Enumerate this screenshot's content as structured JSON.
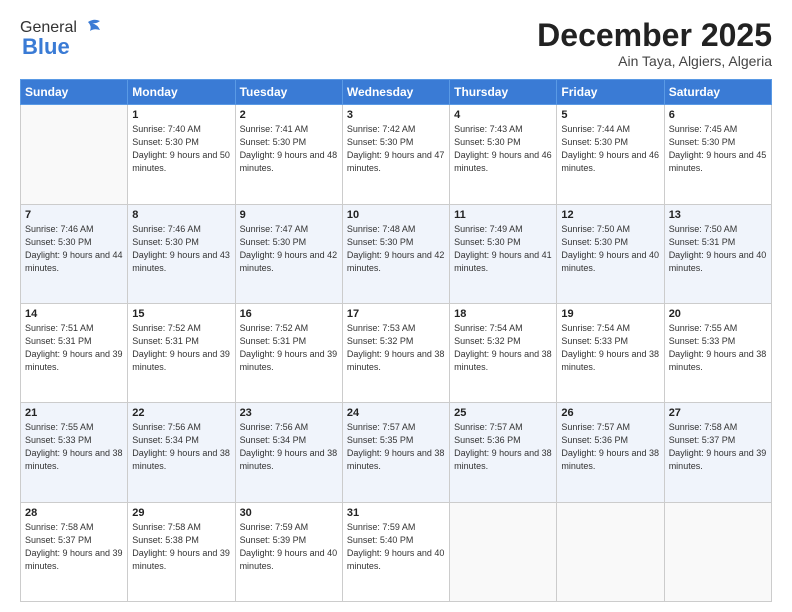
{
  "logo": {
    "general": "General",
    "blue": "Blue"
  },
  "header": {
    "month": "December 2025",
    "location": "Ain Taya, Algiers, Algeria"
  },
  "days_of_week": [
    "Sunday",
    "Monday",
    "Tuesday",
    "Wednesday",
    "Thursday",
    "Friday",
    "Saturday"
  ],
  "weeks": [
    [
      {
        "day": "",
        "sunrise": "",
        "sunset": "",
        "daylight": ""
      },
      {
        "day": "1",
        "sunrise": "Sunrise: 7:40 AM",
        "sunset": "Sunset: 5:30 PM",
        "daylight": "Daylight: 9 hours and 50 minutes."
      },
      {
        "day": "2",
        "sunrise": "Sunrise: 7:41 AM",
        "sunset": "Sunset: 5:30 PM",
        "daylight": "Daylight: 9 hours and 48 minutes."
      },
      {
        "day": "3",
        "sunrise": "Sunrise: 7:42 AM",
        "sunset": "Sunset: 5:30 PM",
        "daylight": "Daylight: 9 hours and 47 minutes."
      },
      {
        "day": "4",
        "sunrise": "Sunrise: 7:43 AM",
        "sunset": "Sunset: 5:30 PM",
        "daylight": "Daylight: 9 hours and 46 minutes."
      },
      {
        "day": "5",
        "sunrise": "Sunrise: 7:44 AM",
        "sunset": "Sunset: 5:30 PM",
        "daylight": "Daylight: 9 hours and 46 minutes."
      },
      {
        "day": "6",
        "sunrise": "Sunrise: 7:45 AM",
        "sunset": "Sunset: 5:30 PM",
        "daylight": "Daylight: 9 hours and 45 minutes."
      }
    ],
    [
      {
        "day": "7",
        "sunrise": "Sunrise: 7:46 AM",
        "sunset": "Sunset: 5:30 PM",
        "daylight": "Daylight: 9 hours and 44 minutes."
      },
      {
        "day": "8",
        "sunrise": "Sunrise: 7:46 AM",
        "sunset": "Sunset: 5:30 PM",
        "daylight": "Daylight: 9 hours and 43 minutes."
      },
      {
        "day": "9",
        "sunrise": "Sunrise: 7:47 AM",
        "sunset": "Sunset: 5:30 PM",
        "daylight": "Daylight: 9 hours and 42 minutes."
      },
      {
        "day": "10",
        "sunrise": "Sunrise: 7:48 AM",
        "sunset": "Sunset: 5:30 PM",
        "daylight": "Daylight: 9 hours and 42 minutes."
      },
      {
        "day": "11",
        "sunrise": "Sunrise: 7:49 AM",
        "sunset": "Sunset: 5:30 PM",
        "daylight": "Daylight: 9 hours and 41 minutes."
      },
      {
        "day": "12",
        "sunrise": "Sunrise: 7:50 AM",
        "sunset": "Sunset: 5:30 PM",
        "daylight": "Daylight: 9 hours and 40 minutes."
      },
      {
        "day": "13",
        "sunrise": "Sunrise: 7:50 AM",
        "sunset": "Sunset: 5:31 PM",
        "daylight": "Daylight: 9 hours and 40 minutes."
      }
    ],
    [
      {
        "day": "14",
        "sunrise": "Sunrise: 7:51 AM",
        "sunset": "Sunset: 5:31 PM",
        "daylight": "Daylight: 9 hours and 39 minutes."
      },
      {
        "day": "15",
        "sunrise": "Sunrise: 7:52 AM",
        "sunset": "Sunset: 5:31 PM",
        "daylight": "Daylight: 9 hours and 39 minutes."
      },
      {
        "day": "16",
        "sunrise": "Sunrise: 7:52 AM",
        "sunset": "Sunset: 5:31 PM",
        "daylight": "Daylight: 9 hours and 39 minutes."
      },
      {
        "day": "17",
        "sunrise": "Sunrise: 7:53 AM",
        "sunset": "Sunset: 5:32 PM",
        "daylight": "Daylight: 9 hours and 38 minutes."
      },
      {
        "day": "18",
        "sunrise": "Sunrise: 7:54 AM",
        "sunset": "Sunset: 5:32 PM",
        "daylight": "Daylight: 9 hours and 38 minutes."
      },
      {
        "day": "19",
        "sunrise": "Sunrise: 7:54 AM",
        "sunset": "Sunset: 5:33 PM",
        "daylight": "Daylight: 9 hours and 38 minutes."
      },
      {
        "day": "20",
        "sunrise": "Sunrise: 7:55 AM",
        "sunset": "Sunset: 5:33 PM",
        "daylight": "Daylight: 9 hours and 38 minutes."
      }
    ],
    [
      {
        "day": "21",
        "sunrise": "Sunrise: 7:55 AM",
        "sunset": "Sunset: 5:33 PM",
        "daylight": "Daylight: 9 hours and 38 minutes."
      },
      {
        "day": "22",
        "sunrise": "Sunrise: 7:56 AM",
        "sunset": "Sunset: 5:34 PM",
        "daylight": "Daylight: 9 hours and 38 minutes."
      },
      {
        "day": "23",
        "sunrise": "Sunrise: 7:56 AM",
        "sunset": "Sunset: 5:34 PM",
        "daylight": "Daylight: 9 hours and 38 minutes."
      },
      {
        "day": "24",
        "sunrise": "Sunrise: 7:57 AM",
        "sunset": "Sunset: 5:35 PM",
        "daylight": "Daylight: 9 hours and 38 minutes."
      },
      {
        "day": "25",
        "sunrise": "Sunrise: 7:57 AM",
        "sunset": "Sunset: 5:36 PM",
        "daylight": "Daylight: 9 hours and 38 minutes."
      },
      {
        "day": "26",
        "sunrise": "Sunrise: 7:57 AM",
        "sunset": "Sunset: 5:36 PM",
        "daylight": "Daylight: 9 hours and 38 minutes."
      },
      {
        "day": "27",
        "sunrise": "Sunrise: 7:58 AM",
        "sunset": "Sunset: 5:37 PM",
        "daylight": "Daylight: 9 hours and 39 minutes."
      }
    ],
    [
      {
        "day": "28",
        "sunrise": "Sunrise: 7:58 AM",
        "sunset": "Sunset: 5:37 PM",
        "daylight": "Daylight: 9 hours and 39 minutes."
      },
      {
        "day": "29",
        "sunrise": "Sunrise: 7:58 AM",
        "sunset": "Sunset: 5:38 PM",
        "daylight": "Daylight: 9 hours and 39 minutes."
      },
      {
        "day": "30",
        "sunrise": "Sunrise: 7:59 AM",
        "sunset": "Sunset: 5:39 PM",
        "daylight": "Daylight: 9 hours and 40 minutes."
      },
      {
        "day": "31",
        "sunrise": "Sunrise: 7:59 AM",
        "sunset": "Sunset: 5:40 PM",
        "daylight": "Daylight: 9 hours and 40 minutes."
      },
      {
        "day": "",
        "sunrise": "",
        "sunset": "",
        "daylight": ""
      },
      {
        "day": "",
        "sunrise": "",
        "sunset": "",
        "daylight": ""
      },
      {
        "day": "",
        "sunrise": "",
        "sunset": "",
        "daylight": ""
      }
    ]
  ]
}
